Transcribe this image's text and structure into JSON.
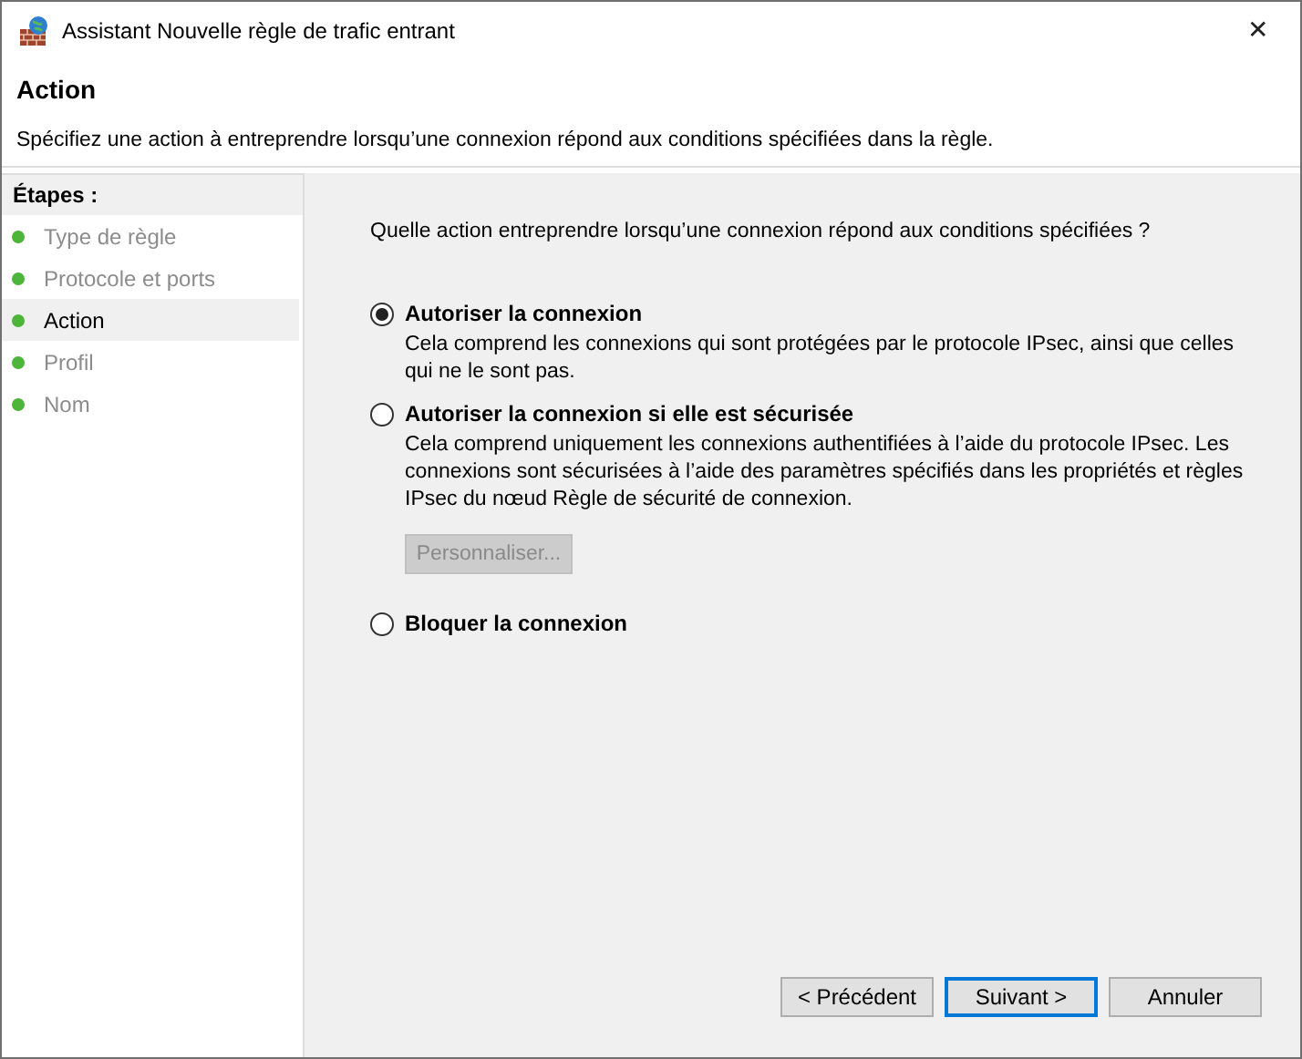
{
  "window": {
    "title": "Assistant Nouvelle règle de trafic entrant",
    "close": "✕"
  },
  "header": {
    "title": "Action",
    "subtitle": "Spécifiez une action à entreprendre lorsqu’une connexion répond aux conditions spécifiées dans la règle."
  },
  "steps": {
    "heading": "Étapes :",
    "items": [
      {
        "label": "Type de règle",
        "selected": false
      },
      {
        "label": "Protocole et ports",
        "selected": false
      },
      {
        "label": "Action",
        "selected": true
      },
      {
        "label": "Profil",
        "selected": false
      },
      {
        "label": "Nom",
        "selected": false
      }
    ]
  },
  "question": "Quelle action entreprendre lorsqu’une connexion répond aux conditions spécifiées ?",
  "options": [
    {
      "label": "Autoriser la connexion",
      "selected": true,
      "description": "Cela comprend les connexions qui sont protégées par le protocole IPsec, ainsi que celles qui ne le sont pas."
    },
    {
      "label": "Autoriser la connexion si elle est sécurisée",
      "selected": false,
      "description": "Cela comprend uniquement les connexions authentifiées à l’aide du protocole IPsec. Les connexions sont sécurisées à l’aide des paramètres spécifiés dans les propriétés et règles IPsec du nœud Règle de sécurité de connexion.",
      "button": {
        "label": "Personnaliser...",
        "disabled": true
      }
    },
    {
      "label": "Bloquer la connexion",
      "selected": false
    }
  ],
  "buttons": [
    {
      "label": "< Précédent",
      "default": false
    },
    {
      "label": "Suivant >",
      "default": true
    },
    {
      "label": "Annuler",
      "default": false
    }
  ]
}
